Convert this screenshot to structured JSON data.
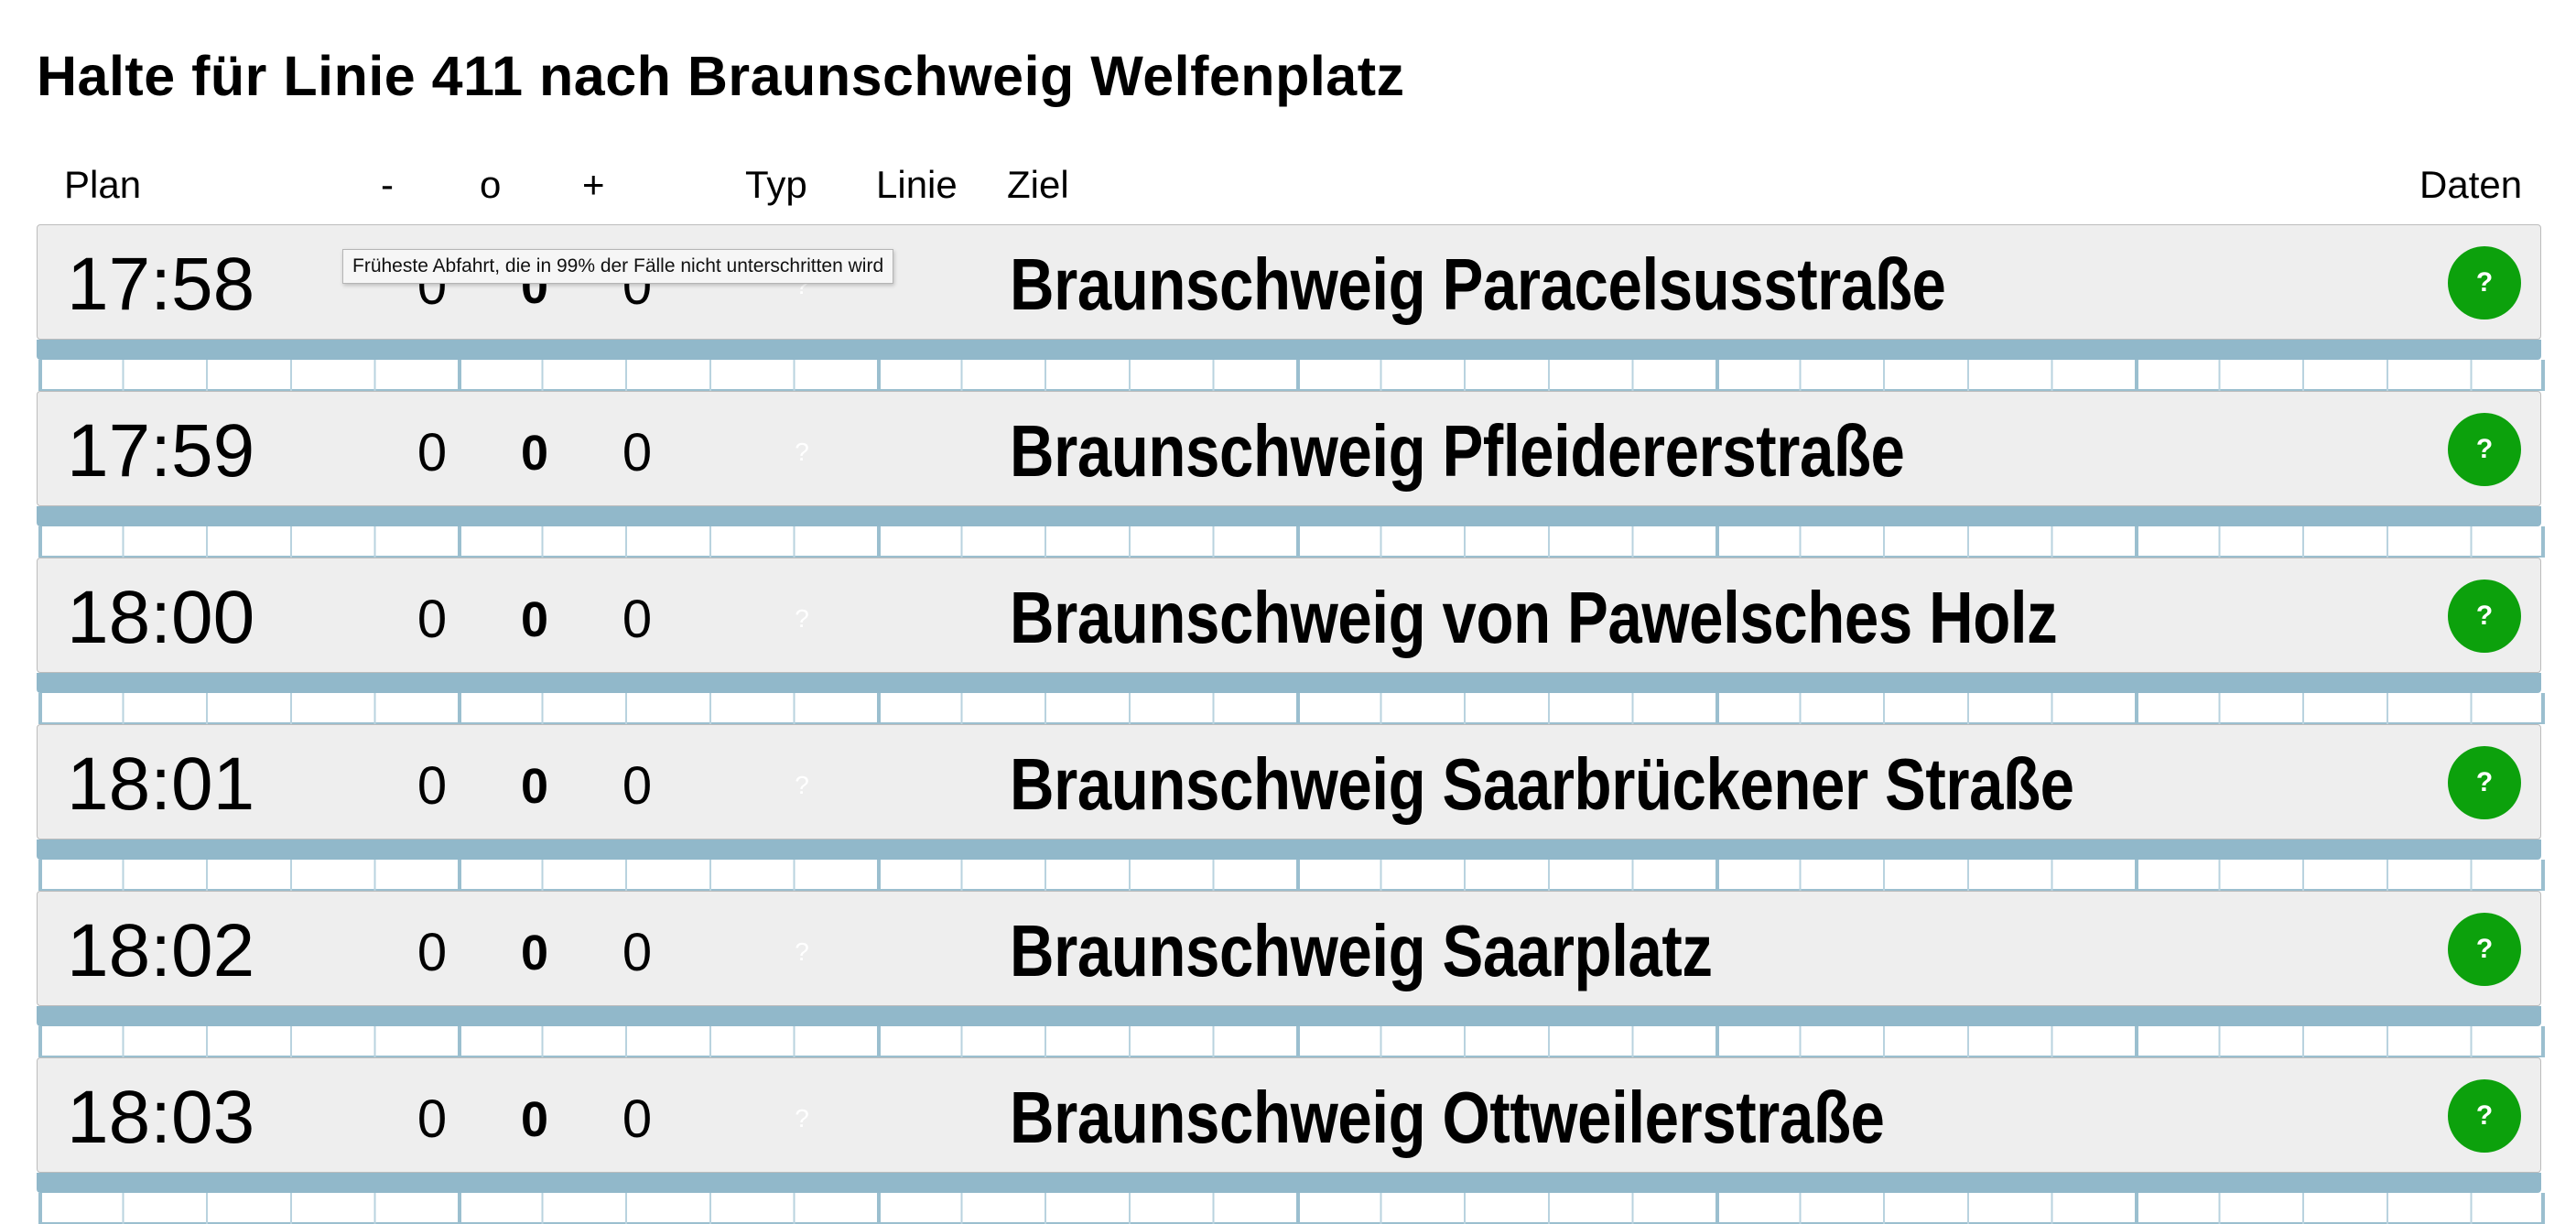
{
  "page": {
    "title": "Halte für Linie 411 nach Braunschweig Welfenplatz"
  },
  "columns": {
    "plan": "Plan",
    "minus": "-",
    "o": "o",
    "plus": "+",
    "typ": "Typ",
    "linie": "Linie",
    "ziel": "Ziel",
    "daten": "Daten"
  },
  "rows": [
    {
      "plan": "17:58",
      "dev_min": "0",
      "dev_mid": "0",
      "dev_max": "0",
      "typ": "?",
      "ziel": "Braunschweig Paracelsusstraße",
      "daten": "?"
    },
    {
      "plan": "17:59",
      "dev_min": "0",
      "dev_mid": "0",
      "dev_max": "0",
      "typ": "?",
      "ziel": "Braunschweig Pfleidererstraße",
      "daten": "?"
    },
    {
      "plan": "18:00",
      "dev_min": "0",
      "dev_mid": "0",
      "dev_max": "0",
      "typ": "?",
      "ziel": "Braunschweig von Pawelsches Holz",
      "daten": "?"
    },
    {
      "plan": "18:01",
      "dev_min": "0",
      "dev_mid": "0",
      "dev_max": "0",
      "typ": "?",
      "ziel": "Braunschweig Saarbrückener Straße",
      "daten": "?"
    },
    {
      "plan": "18:02",
      "dev_min": "0",
      "dev_mid": "0",
      "dev_max": "0",
      "typ": "?",
      "ziel": "Braunschweig Saarplatz",
      "daten": "?"
    },
    {
      "plan": "18:03",
      "dev_min": "0",
      "dev_mid": "0",
      "dev_max": "0",
      "typ": "?",
      "ziel": "Braunschweig Ottweilerstraße",
      "daten": "?"
    }
  ],
  "tooltip": {
    "text": "Früheste Abfahrt, die in 99% der Fälle nicht unterschritten wird"
  },
  "colors": {
    "row_background": "#eeeeee",
    "timeline_bar": "#91b8ca",
    "daten_button": "#0ca10c"
  }
}
